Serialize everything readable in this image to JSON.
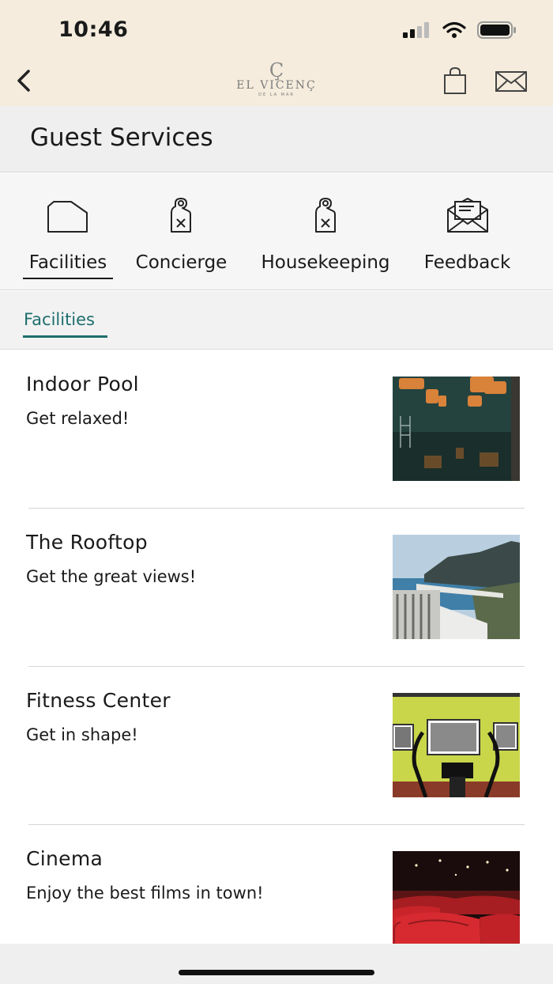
{
  "status": {
    "time": "10:46"
  },
  "header": {
    "logo_mark": "Ç",
    "logo_name": "EL VICENÇ",
    "logo_sub": "DE LA MAR"
  },
  "page": {
    "title": "Guest Services"
  },
  "categories": [
    {
      "label": "Facilities",
      "icon": "building-icon",
      "active": true
    },
    {
      "label": "Concierge",
      "icon": "door-hanger-icon",
      "active": false
    },
    {
      "label": "Housekeeping",
      "icon": "door-hanger-icon",
      "active": false
    },
    {
      "label": "Feedback",
      "icon": "envelope-icon",
      "active": false
    }
  ],
  "subtabs": [
    {
      "label": "Facilities",
      "active": true
    }
  ],
  "facilities": [
    {
      "title": "Indoor Pool",
      "description": "Get relaxed!",
      "image": "indoor-pool-photo"
    },
    {
      "title": "The Rooftop",
      "description": "Get the great views!",
      "image": "rooftop-photo"
    },
    {
      "title": "Fitness Center",
      "description": "Get in shape!",
      "image": "fitness-center-photo"
    },
    {
      "title": "Cinema",
      "description": "Enjoy the best films in town!",
      "image": "cinema-photo"
    }
  ],
  "colors": {
    "header_bg": "#f5ecdd",
    "accent": "#1f6e6e"
  }
}
